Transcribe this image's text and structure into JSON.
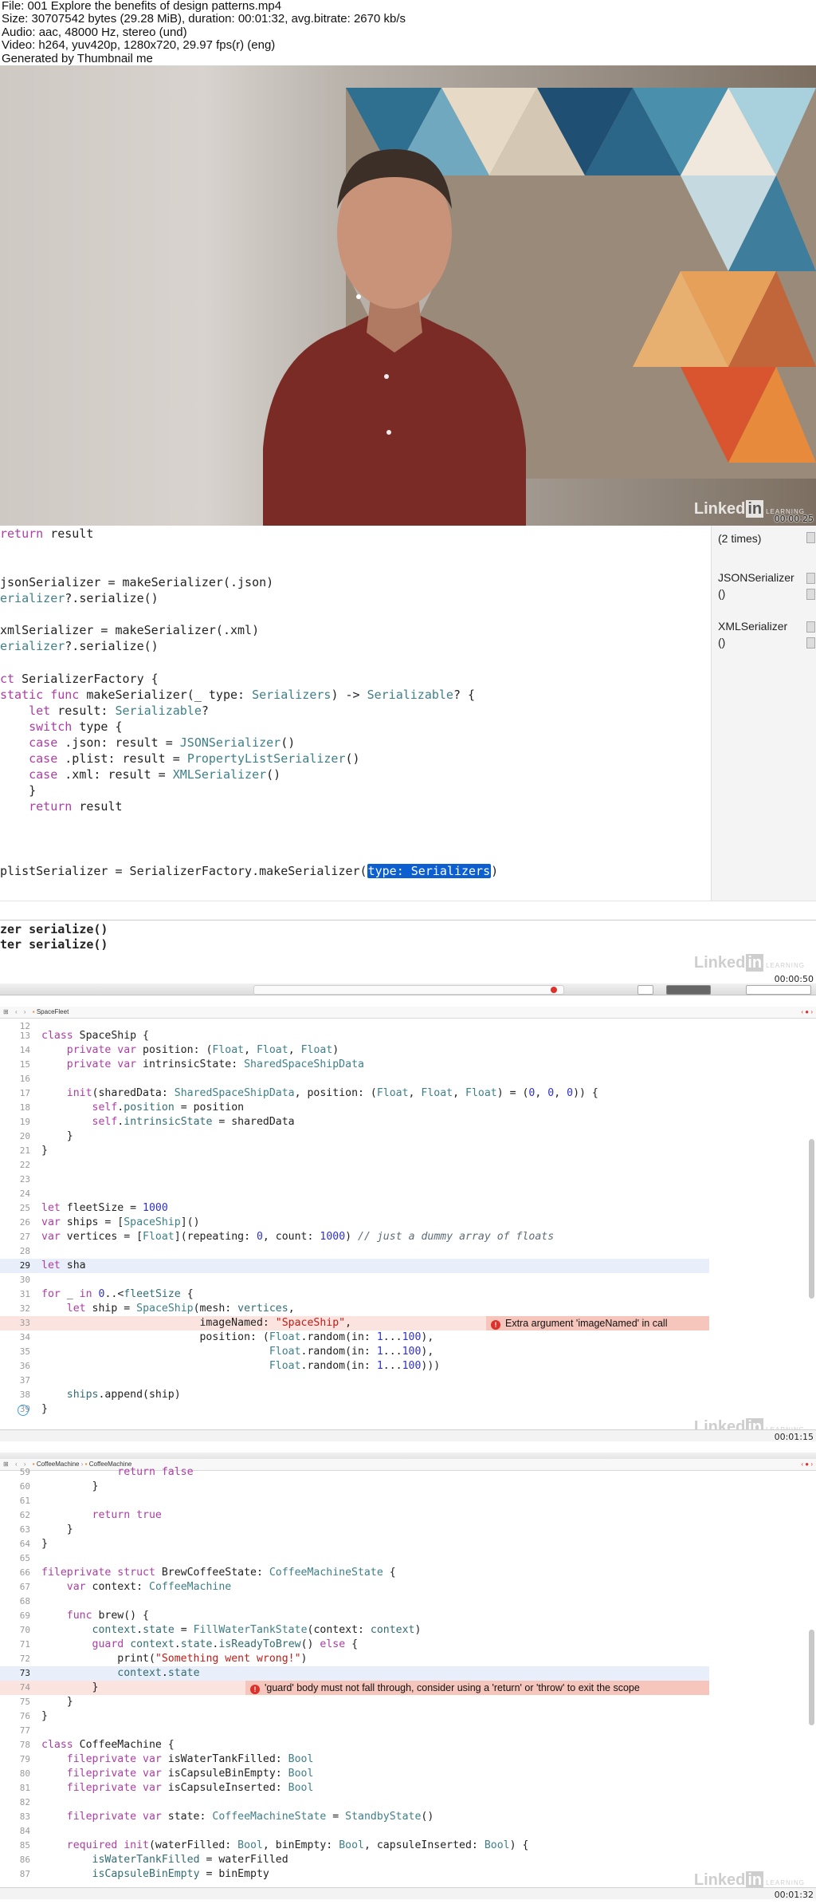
{
  "header": {
    "lines": [
      "File: 001 Explore the benefits of design patterns.mp4",
      "Size: 30707542 bytes (29.28 MiB), duration: 00:01:32, avg.bitrate: 2670 kb/s",
      "Audio: aac, 48000 Hz, stereo (und)",
      "Video: h264, yuv420p, 1280x720, 29.97 fps(r) (eng)",
      "Generated by Thumbnail me"
    ]
  },
  "frames": {
    "video": {
      "timestamp": "00:00:25",
      "watermark": "Linked",
      "watermark_in": "in",
      "watermark_sub": "LEARNING"
    },
    "playground": {
      "timestamp": "00:00:50",
      "watermark": "Linked",
      "watermark_in": "in",
      "watermark_sub": "LEARNING",
      "sidebar": {
        "times": "(2 times)",
        "json_label": "JSONSerializer",
        "json_paren": "()",
        "xml_label": "XMLSerializer",
        "xml_paren": "()"
      },
      "console_lines": [
        "zer serialize()",
        "ter serialize()"
      ],
      "error_count": "1"
    },
    "spacefleet": {
      "timestamp": "00:01:15",
      "breadcrumb": "SpaceFleet",
      "watermark": "Linked",
      "watermark_in": "in",
      "watermark_sub": "LEARNING",
      "error_message": "Extra argument 'imageNamed' in call",
      "line_numbers": [
        "12",
        "13",
        "14",
        "15",
        "16",
        "17",
        "18",
        "19",
        "20",
        "21",
        "22",
        "23",
        "24",
        "25",
        "26",
        "27",
        "28",
        "29",
        "30",
        "31",
        "32",
        "33",
        "34",
        "35",
        "36",
        "37",
        "38",
        "39"
      ]
    },
    "coffee": {
      "timestamp": "00:01:32",
      "breadcrumb_1": "CoffeeMachine",
      "breadcrumb_2": "CoffeeMachine",
      "watermark": "Linked",
      "watermark_in": "in",
      "watermark_sub": "LEARNING",
      "error_message": "'guard' body must not fall through, consider using a 'return' or 'throw' to exit the scope",
      "line_numbers": [
        "59",
        "60",
        "61",
        "62",
        "63",
        "64",
        "65",
        "66",
        "67",
        "68",
        "69",
        "70",
        "71",
        "72",
        "73",
        "74",
        "75",
        "76",
        "77",
        "78",
        "79",
        "80",
        "81",
        "82",
        "83",
        "84",
        "85",
        "86",
        "87"
      ]
    }
  },
  "colors": {
    "keyword": "#ad3da4",
    "type": "#3e7f88",
    "number": "#2f32c8",
    "string": "#c41a16",
    "error_bg": "#f6c6bd",
    "selection": "#0b5fd0"
  }
}
